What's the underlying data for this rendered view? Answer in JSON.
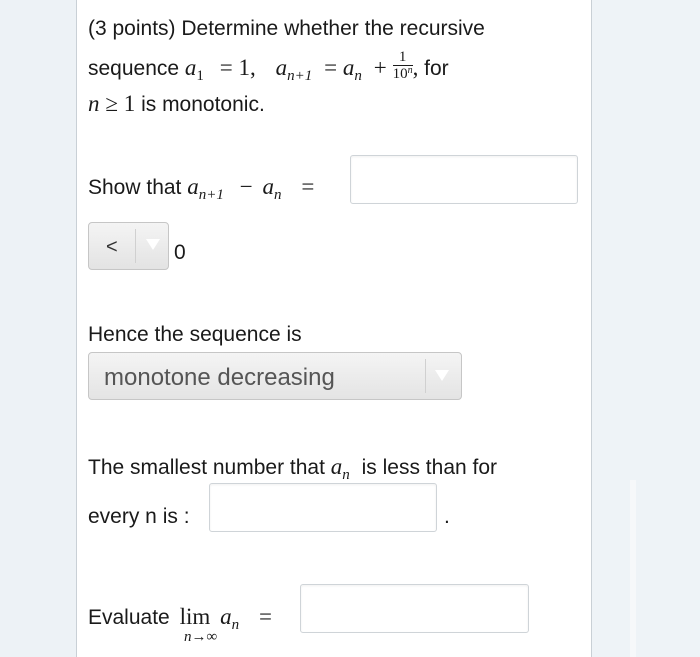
{
  "question": {
    "intro": "(3 points) Determine whether the recursive",
    "line2_prefix": "sequence",
    "a1_var": "a",
    "a1_sub": "1",
    "a1_eq": "= 1,",
    "an1_var": "a",
    "an1_sub": "n+1",
    "an1_eq": "=",
    "an_var": "a",
    "an_sub": "n",
    "plus": "+",
    "frac_num": "1",
    "frac_den_base": "10",
    "frac_den_exp": "n",
    "comma": ",",
    "for_text": "for",
    "cond_var": "n",
    "cond_rel": "≥ 1",
    "cond_text": "is monotonic."
  },
  "show_that": {
    "label": "Show that",
    "lhs_var": "a",
    "lhs_sub": "n+1",
    "minus": "−",
    "rhs_var": "a",
    "rhs_sub": "n",
    "eq": "=",
    "answer_value": ""
  },
  "comparison": {
    "selected": "<",
    "value": "0"
  },
  "sequence_type": {
    "label": "Hence the sequence is",
    "selected": "monotone decreasing"
  },
  "smallest": {
    "prefix": "The smallest number that",
    "var": "a",
    "sub": "n",
    "suffix": "is less than for",
    "line2": "every n is :",
    "period": ".",
    "answer_value": ""
  },
  "limit": {
    "label": "Evaluate",
    "lim": "lim",
    "lim_sub": "n→∞",
    "var": "a",
    "sub": "n",
    "eq": "=",
    "answer_value": ""
  }
}
